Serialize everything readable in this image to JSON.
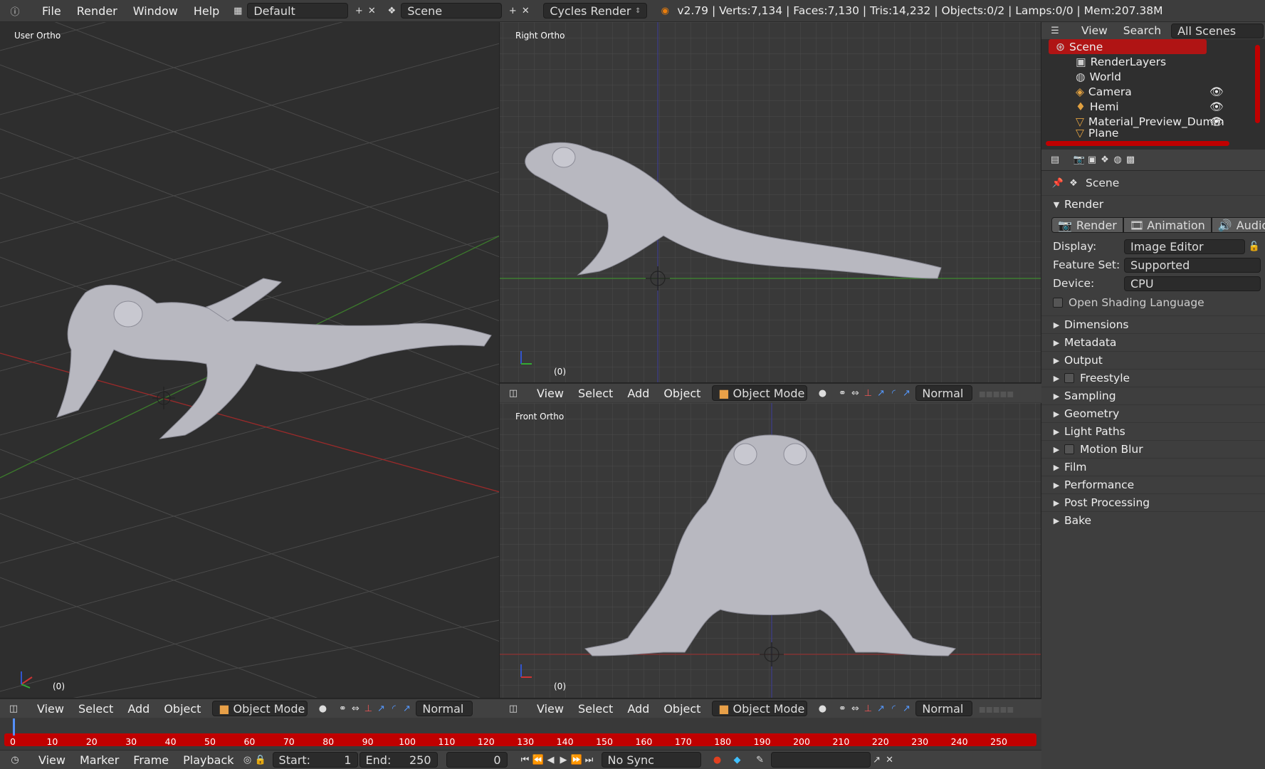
{
  "topbar": {
    "menu": [
      "File",
      "Render",
      "Window",
      "Help"
    ],
    "layout": "Default",
    "scene": "Scene",
    "engine": "Cycles Render",
    "stats": "v2.79 | Verts:7,134 | Faces:7,130 | Tris:14,232 | Objects:0/2 | Lamps:0/0 | Mem:207.38M"
  },
  "viewports": {
    "user": {
      "label": "User Ortho",
      "frame": "(0)"
    },
    "right": {
      "label": "Right Ortho",
      "frame": "(0)"
    },
    "front": {
      "label": "Front Ortho",
      "frame": "(0)"
    }
  },
  "viewport_header": {
    "menu": [
      "View",
      "Select",
      "Add",
      "Object"
    ],
    "mode": "Object Mode",
    "orientation": "Normal"
  },
  "outliner": {
    "tabs": [
      "View",
      "Search",
      "All Scenes"
    ],
    "items": [
      "Scene",
      "RenderLayers",
      "World",
      "Camera",
      "Hemi",
      "Material_Preview_Dumm",
      "Plane"
    ]
  },
  "properties": {
    "context": "Scene",
    "panel": "Render",
    "buttons": [
      "Render",
      "Animation",
      "Audio"
    ],
    "display_label": "Display:",
    "display_value": "Image Editor",
    "feature_label": "Feature Set:",
    "feature_value": "Supported",
    "device_label": "Device:",
    "device_value": "CPU",
    "osl_label": "Open Shading Language",
    "panels": [
      "Dimensions",
      "Metadata",
      "Output",
      "Freestyle",
      "Sampling",
      "Geometry",
      "Light Paths",
      "Motion Blur",
      "Film",
      "Performance",
      "Post Processing",
      "Bake"
    ]
  },
  "timeline": {
    "ticks": [
      "0",
      "10",
      "20",
      "30",
      "40",
      "50",
      "60",
      "70",
      "80",
      "90",
      "100",
      "110",
      "120",
      "130",
      "140",
      "150",
      "160",
      "170",
      "180",
      "190",
      "200",
      "210",
      "220",
      "230",
      "240",
      "250"
    ],
    "menu": [
      "View",
      "Marker",
      "Frame",
      "Playback"
    ],
    "start_label": "Start:",
    "start_value": "1",
    "end_label": "End:",
    "end_value": "250",
    "current": "0",
    "sync": "No Sync"
  },
  "colors": {
    "accent": "#c00000",
    "outliner_selected": "#b01414",
    "grid": "#4a4a4a"
  }
}
